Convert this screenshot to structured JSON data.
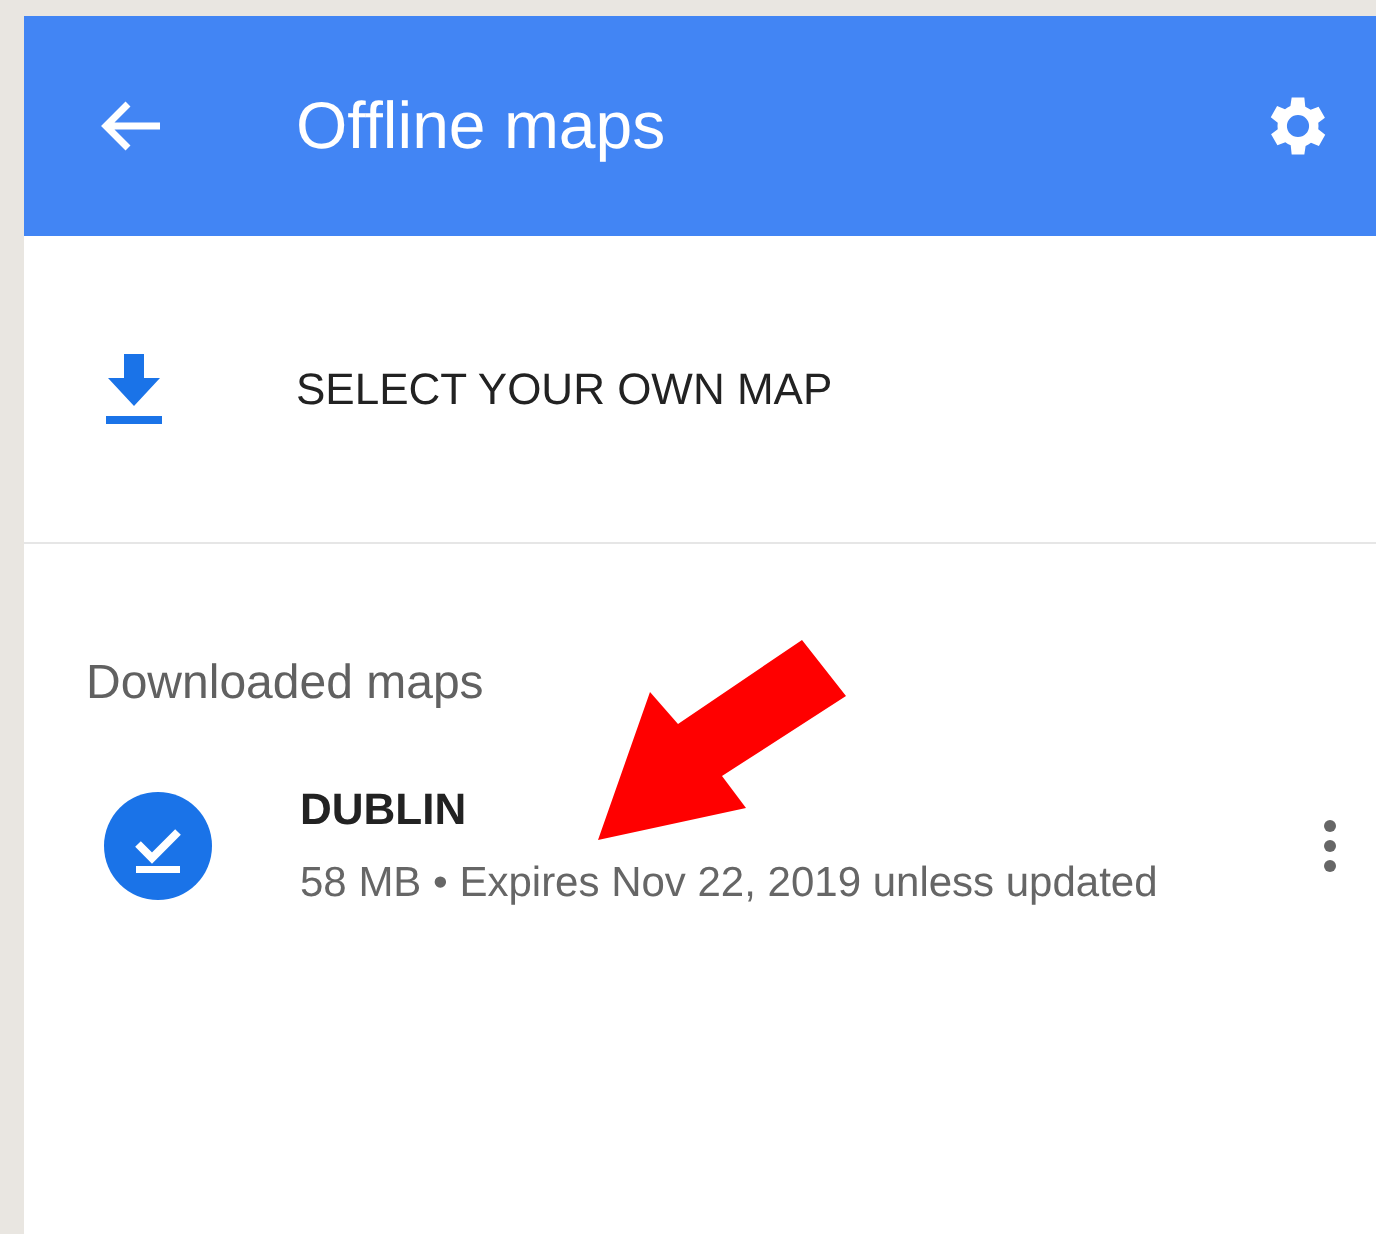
{
  "app_bar": {
    "title": "Offline maps"
  },
  "select_action": {
    "label": "SELECT YOUR OWN MAP"
  },
  "section": {
    "title": "Downloaded maps"
  },
  "maps": [
    {
      "name": "DUBLIN",
      "details": "58 MB • Expires Nov 22, 2019 unless updated",
      "downloaded": true
    }
  ],
  "annotation": {
    "kind": "arrow"
  }
}
